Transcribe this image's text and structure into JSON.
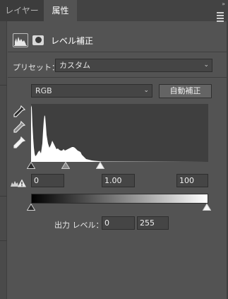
{
  "tabs": {
    "layers_label": "レイヤー",
    "properties_label": "属性",
    "collapse_glyph": "»"
  },
  "header": {
    "title": "レベル補正"
  },
  "preset": {
    "label": "プリセット：",
    "value": "カスタム"
  },
  "channel": {
    "value": "RGB",
    "auto_label": "自動補正"
  },
  "input_levels": {
    "black": "0",
    "gamma": "1.00",
    "white": "100"
  },
  "output_levels": {
    "label": "出力 レベル：",
    "black": "0",
    "white": "255"
  },
  "colors": {
    "panel_bg": "#535353",
    "tab_bg": "#434343",
    "histogram_bg": "#3f3f3f",
    "histogram_fill": "#ffffff"
  },
  "icons": [
    "levels-histogram-icon",
    "layer-mask-icon",
    "black-eyedropper-icon",
    "gray-eyedropper-icon",
    "white-eyedropper-icon",
    "clipping-warning-icon",
    "panel-menu-icon"
  ]
}
